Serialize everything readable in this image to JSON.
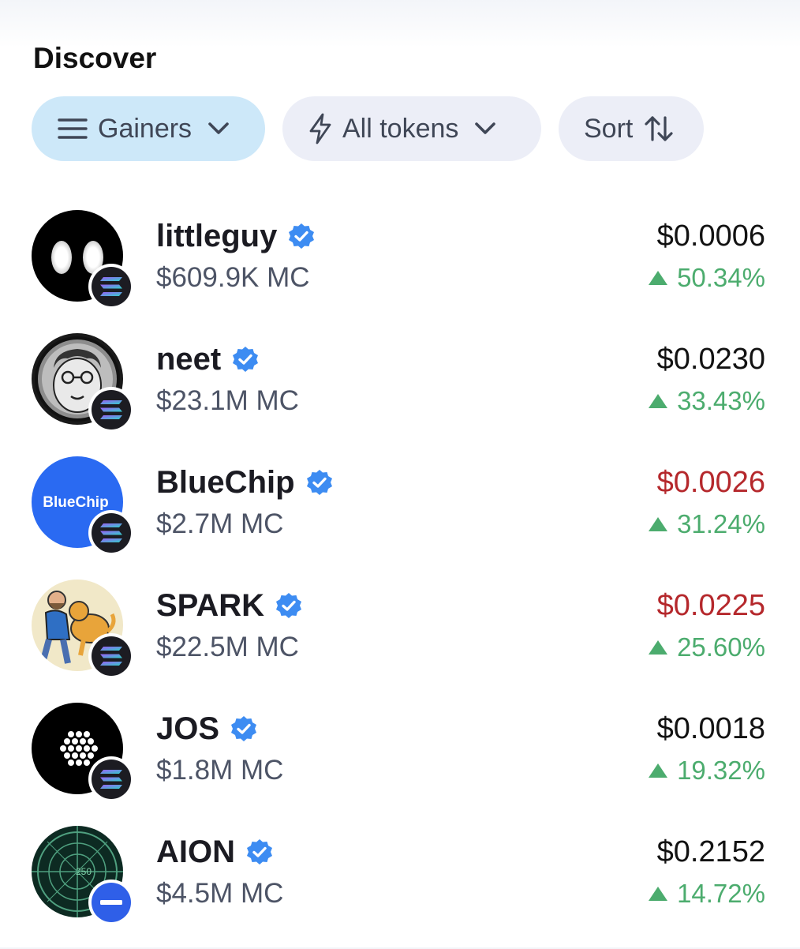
{
  "header": {
    "title": "Discover"
  },
  "filters": {
    "category": "Gainers",
    "tokens": "All tokens",
    "sort": "Sort"
  },
  "colors": {
    "gain": "#4cac6e",
    "price_red": "#b5282c",
    "verified": "#3d8cf2",
    "active_pill": "#cde8f9",
    "pill": "#eceef7"
  },
  "tokens": [
    {
      "name": "littleguy",
      "market_cap": "$609.9K MC",
      "price": "$0.0006",
      "change": "50.34%",
      "price_color": "default",
      "chain_icon": "solana-icon"
    },
    {
      "name": "neet",
      "market_cap": "$23.1M MC",
      "price": "$0.0230",
      "change": "33.43%",
      "price_color": "default",
      "chain_icon": "solana-icon"
    },
    {
      "name": "BlueChip",
      "market_cap": "$2.7M MC",
      "price": "$0.0026",
      "change": "31.24%",
      "price_color": "red",
      "chain_icon": "solana-icon",
      "logo_text": "BlueChip"
    },
    {
      "name": "SPARK",
      "market_cap": "$22.5M MC",
      "price": "$0.0225",
      "change": "25.60%",
      "price_color": "red",
      "chain_icon": "solana-icon"
    },
    {
      "name": "JOS",
      "market_cap": "$1.8M MC",
      "price": "$0.0018",
      "change": "19.32%",
      "price_color": "default",
      "chain_icon": "solana-icon"
    },
    {
      "name": "AION",
      "market_cap": "$4.5M MC",
      "price": "$0.2152",
      "change": "14.72%",
      "price_color": "default",
      "chain_icon": "base-icon",
      "logo_text": "250"
    }
  ]
}
